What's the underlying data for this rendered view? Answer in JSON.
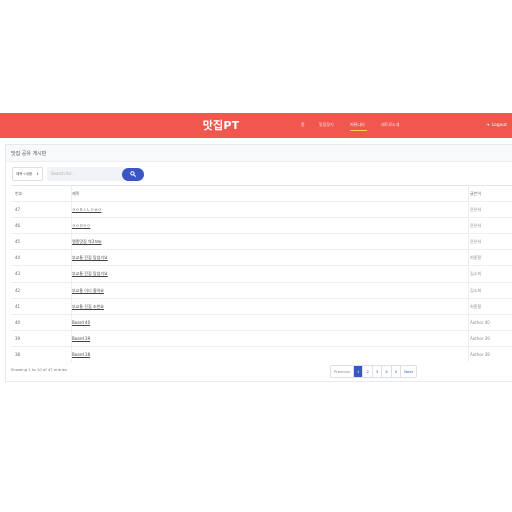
{
  "navbar": {
    "brand": "맛집PT",
    "items": [
      {
        "label": "홈"
      },
      {
        "label": "맛집찾기"
      },
      {
        "label": "커뮤니티"
      },
      {
        "label": "레트로소개"
      }
    ],
    "logout_label": "Logout",
    "logout_icon": "arrow-right-icon",
    "colors": {
      "bar": "#f0574f",
      "active_underline": "#ffd84d"
    }
  },
  "board": {
    "title": "맛집 공유 게시판",
    "filter_selected": "제목+내용",
    "search_placeholder": "Search for...",
    "search_icon": "search-icon",
    "columns": {
      "num": "번호",
      "title": "제목",
      "author": "글쓴이"
    },
    "rows": [
      {
        "num": "47",
        "title": "ㅇㅇㅍㅅㄴㅇㅂㅇ",
        "author": "윤은하"
      },
      {
        "num": "46",
        "title": "ㅇㅇㅁㅇㅇ",
        "author": "윤은하"
      },
      {
        "num": "45",
        "title": "맹종맛집 싹3꼬씨",
        "author": "윤은하"
      },
      {
        "num": "44",
        "title": "부교통 진집 탐엄거요",
        "author": "허종철"
      },
      {
        "num": "43",
        "title": "부교통 진집 탐엄거요",
        "author": "김소희"
      },
      {
        "num": "42",
        "title": "부교통 이디 졸아요",
        "author": "김소희"
      },
      {
        "num": "41",
        "title": "부교통 진집 조천요",
        "author": "허종철"
      },
      {
        "num": "40",
        "title": "Board 40",
        "author": "Author 40"
      },
      {
        "num": "39",
        "title": "Board 39",
        "author": "Author 39"
      },
      {
        "num": "38",
        "title": "Board 38",
        "author": "Author 38"
      }
    ],
    "info": "Showing 1 to 10 of 47 entries",
    "pagination": {
      "previous": "Previous",
      "pages": [
        "1",
        "2",
        "3",
        "4",
        "5"
      ],
      "current": "1",
      "next": "Next"
    },
    "colors": {
      "primary": "#3a56c5"
    }
  }
}
